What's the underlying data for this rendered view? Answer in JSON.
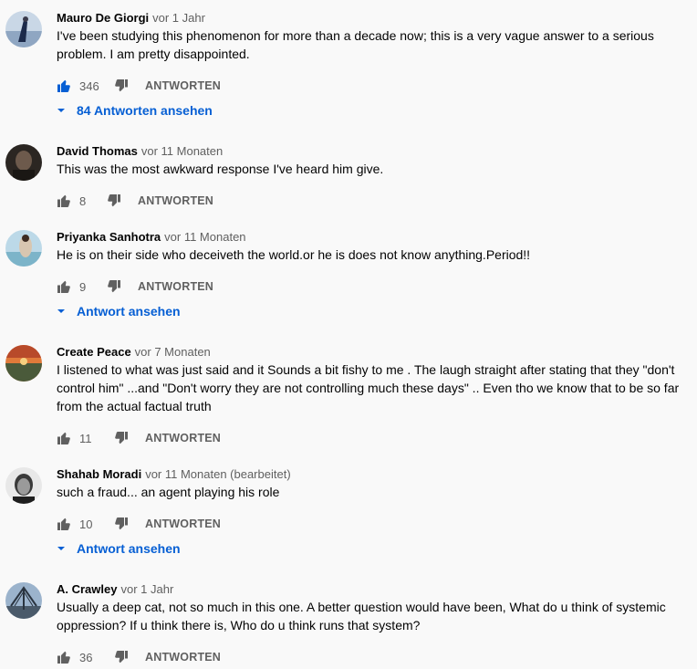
{
  "reply_label": "ANTWORTEN",
  "comments": [
    {
      "author": "Mauro De Giorgi",
      "time": "vor 1 Jahr",
      "text": "I've been studying this phenomenon for more than a decade now; this is a very vague answer to a serious problem. I am pretty disappointed.",
      "likes": "346",
      "liked": true,
      "replies": "84 Antworten ansehen"
    },
    {
      "author": "David Thomas",
      "time": "vor 11 Monaten",
      "text": "This was the most awkward response I've heard him give.",
      "likes": "8",
      "liked": false,
      "replies": ""
    },
    {
      "author": "Priyanka Sanhotra",
      "time": "vor 11 Monaten",
      "text": "He is on their side who deceiveth the world.or he is does not know anything.Period!!",
      "likes": "9",
      "liked": false,
      "replies": "Antwort ansehen"
    },
    {
      "author": "Create Peace",
      "time": "vor 7 Monaten",
      "text": "I listened to what was just said and it Sounds a bit fishy to me . The laugh straight after stating that they \"don't control him\" ...and \"Don't worry they are not controlling much these days\"  .. Even tho we know that to be so far from the actual factual truth",
      "likes": "11",
      "liked": false,
      "replies": ""
    },
    {
      "author": "Shahab Moradi",
      "time": "vor 11 Monaten (bearbeitet)",
      "text": "such a fraud... an agent playing his role",
      "likes": "10",
      "liked": false,
      "replies": "Antwort ansehen"
    },
    {
      "author": "A. Crawley",
      "time": "vor 1 Jahr",
      "text": "Usually a deep cat, not so much in this one. A better question would have been, What do u think of systemic oppression? If u think there is, Who do u think runs that system?",
      "likes": "36",
      "liked": false,
      "replies": ""
    }
  ],
  "colors": {
    "accent": "#065fd4",
    "like_active": "#065fd4",
    "muted": "#606060",
    "background": "#f9f9f9"
  },
  "icons": {
    "like": "thumbs-up-icon",
    "dislike": "thumbs-down-icon",
    "expand": "caret-down-icon"
  }
}
